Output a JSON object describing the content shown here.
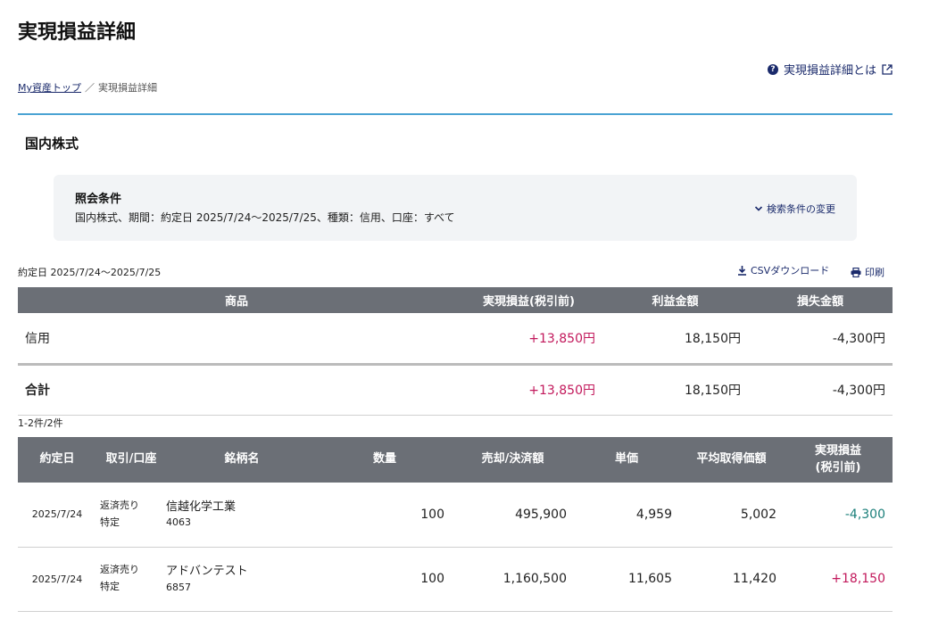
{
  "page": {
    "title": "実現損益詳細",
    "help_label": "実現損益詳細とは",
    "colors": {
      "accent_rule": "#4aa3d3",
      "header_bg": "#6b6f76",
      "positive": "#c2185b",
      "negative": "#1b7f7a",
      "link": "#1a2a6b"
    }
  },
  "breadcrumb": {
    "home": "My資産トップ",
    "separator": "／",
    "current": "実現損益詳細"
  },
  "section": {
    "title": "国内株式"
  },
  "conditions": {
    "title": "照会条件",
    "text": "国内株式、期間：約定日 2025/7/24〜2025/7/25、種類：信用、口座：すべて",
    "change_label": "検索条件の変更"
  },
  "toolbar": {
    "period": "約定日 2025/7/24〜2025/7/25",
    "csv_label": "CSVダウンロード",
    "print_label": "印刷"
  },
  "summary": {
    "headers": [
      "商品",
      "実現損益(税引前)",
      "利益金額",
      "損失金額"
    ],
    "rows": [
      {
        "label": "信用",
        "realized": "+13,850円",
        "profit": "18,150円",
        "loss": "-4,300円"
      },
      {
        "label": "合計",
        "realized": "+13,850円",
        "profit": "18,150円",
        "loss": "-4,300円"
      }
    ]
  },
  "count": "1-2件/2件",
  "detail": {
    "headers": {
      "date": "約定日",
      "trade": "取引/口座",
      "name": "銘柄名",
      "qty": "数量",
      "amount": "売却/決済額",
      "price": "単価",
      "avg": "平均取得価額",
      "pl_line1": "実現損益",
      "pl_line2": "(税引前)"
    },
    "rows": [
      {
        "date": "2025/7/24",
        "trade": "返済売り",
        "account": "特定",
        "name": "信越化学工業",
        "code": "4063",
        "qty": "100",
        "amount": "495,900",
        "price": "4,959",
        "avg": "5,002",
        "pl": "-4,300"
      },
      {
        "date": "2025/7/24",
        "trade": "返済売り",
        "account": "特定",
        "name": "アドバンテスト",
        "code": "6857",
        "qty": "100",
        "amount": "1,160,500",
        "price": "11,605",
        "avg": "11,420",
        "pl": "+18,150"
      }
    ]
  },
  "icons": {
    "help": "question-circle-icon",
    "external": "external-link-icon",
    "chevron": "chevron-down-icon",
    "download": "download-icon",
    "print": "printer-icon"
  }
}
